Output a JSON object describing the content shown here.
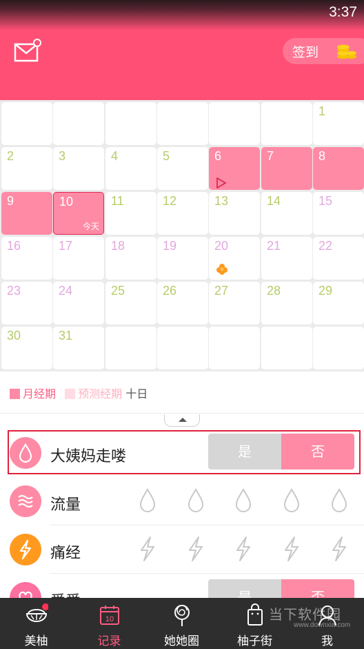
{
  "status_bar": {
    "time": "3:37"
  },
  "header": {
    "checkin_label": "签到"
  },
  "calendar": {
    "rows": [
      [
        {
          "day": ""
        },
        {
          "day": ""
        },
        {
          "day": ""
        },
        {
          "day": ""
        },
        {
          "day": ""
        },
        {
          "day": ""
        },
        {
          "day": "1",
          "color": "#b5cc6a"
        }
      ],
      [
        {
          "day": "2",
          "color": "#b5cc6a"
        },
        {
          "day": "3",
          "color": "#b5cc6a"
        },
        {
          "day": "4",
          "color": "#b5cc6a"
        },
        {
          "day": "5",
          "color": "#b5cc6a"
        },
        {
          "day": "6",
          "color": "#ffffff",
          "state": "period",
          "marker": "play-marker-icon"
        },
        {
          "day": "7",
          "color": "#ffffff",
          "state": "period"
        },
        {
          "day": "8",
          "color": "#ffffff",
          "state": "period"
        }
      ],
      [
        {
          "day": "9",
          "color": "#ffffff",
          "state": "period"
        },
        {
          "day": "10",
          "color": "#ffffff",
          "state": "today",
          "tag": "今天"
        },
        {
          "day": "11",
          "color": "#b5cc6a"
        },
        {
          "day": "12",
          "color": "#b5cc6a"
        },
        {
          "day": "13",
          "color": "#b5cc6a"
        },
        {
          "day": "14",
          "color": "#b5cc6a"
        },
        {
          "day": "15",
          "color": "#e2a8dd"
        }
      ],
      [
        {
          "day": "16",
          "color": "#e2a8dd"
        },
        {
          "day": "17",
          "color": "#e2a8dd"
        },
        {
          "day": "18",
          "color": "#e2a8dd"
        },
        {
          "day": "19",
          "color": "#e2a8dd"
        },
        {
          "day": "20",
          "color": "#e2a8dd",
          "marker": "ovulation-flower-icon"
        },
        {
          "day": "21",
          "color": "#e2a8dd"
        },
        {
          "day": "22",
          "color": "#e2a8dd"
        }
      ],
      [
        {
          "day": "23",
          "color": "#e2a8dd"
        },
        {
          "day": "24",
          "color": "#e2a8dd"
        },
        {
          "day": "25",
          "color": "#b5cc6a"
        },
        {
          "day": "26",
          "color": "#b5cc6a"
        },
        {
          "day": "27",
          "color": "#b5cc6a"
        },
        {
          "day": "28",
          "color": "#b5cc6a"
        },
        {
          "day": "29",
          "color": "#b5cc6a"
        }
      ],
      [
        {
          "day": "30",
          "color": "#b5cc6a"
        },
        {
          "day": "31",
          "color": "#b5cc6a"
        },
        {
          "day": ""
        },
        {
          "day": ""
        },
        {
          "day": ""
        },
        {
          "day": ""
        },
        {
          "day": ""
        }
      ]
    ]
  },
  "legend": {
    "period_label": "月经期",
    "predicted_label": "预测经期",
    "day_count": "十日",
    "colors": {
      "period": "#ff8aa5",
      "predicted": "#ffdbe4",
      "period_text": "#ff5c82",
      "predicted_text": "#ffb0c2"
    }
  },
  "records": {
    "period": {
      "label": "大姨妈走喽",
      "yes": "是",
      "no": "否",
      "selected": "否"
    },
    "flow": {
      "label": "流量",
      "levels": 5
    },
    "cramps": {
      "label": "痛经",
      "levels": 5
    },
    "love": {
      "label": "爱爱",
      "yes": "是",
      "no": "否"
    }
  },
  "bottom_nav": [
    {
      "label": "美柚",
      "icon": "grapefruit-icon"
    },
    {
      "label": "记录",
      "icon": "calendar-icon",
      "active": true
    },
    {
      "label": "她她圈",
      "icon": "lollipop-icon"
    },
    {
      "label": "柚子街",
      "icon": "shopping-bag-icon"
    },
    {
      "label": "我",
      "icon": "profile-icon"
    }
  ],
  "watermark": {
    "brand": "当下软件园",
    "url": "www.downxia.com"
  },
  "colors": {
    "brand": "#ff4f75",
    "accent_pink": "#ff8aa5",
    "nav_bg": "#2e2e2e"
  }
}
